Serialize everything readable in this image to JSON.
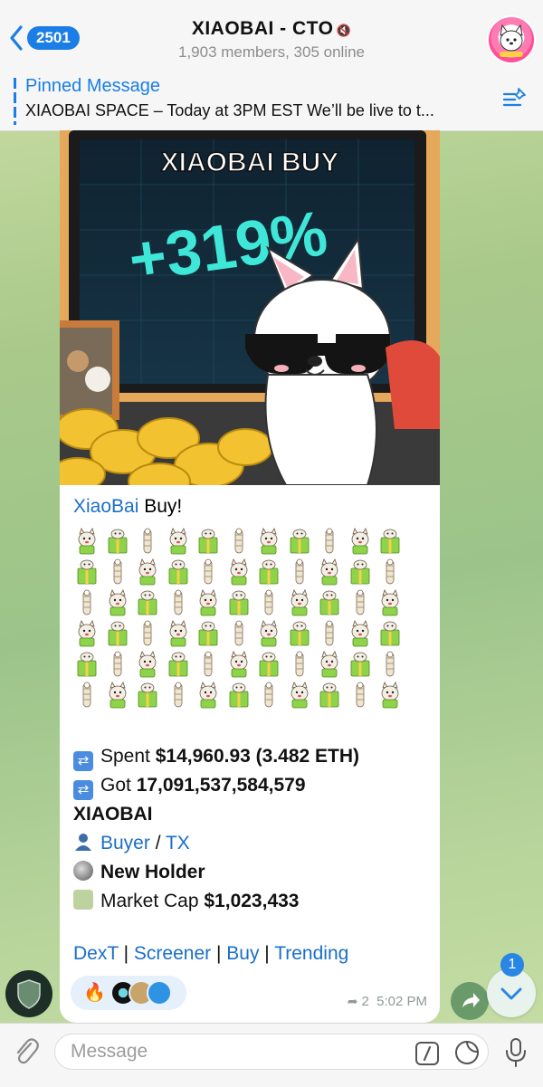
{
  "header": {
    "back_count": "2501",
    "title": "XIAOBAI - CTO",
    "members": "1,903 members, 305 online"
  },
  "pinned": {
    "label": "Pinned Message",
    "text": "XIAOBAI SPACE – Today at 3PM EST We’ll be live to t..."
  },
  "media": {
    "banner_text": "XIAOBAI BUY",
    "percent_text": "+319%"
  },
  "message": {
    "sender": "XiaoBai",
    "sender_suffix": " Buy!",
    "spent_label": "Spent ",
    "spent_value": "$14,960.93 (3.482 ETH)",
    "got_label": "Got ",
    "got_value": "17,091,537,584,579",
    "token": "XIAOBAI",
    "buyer_link": "Buyer",
    "slash": " / ",
    "tx_link": "TX",
    "holder_label": "New Holder",
    "mcap_label": "Market Cap ",
    "mcap_value": "$1,023,433",
    "links": {
      "dext": "DexT",
      "screener": "Screener",
      "buy": "Buy",
      "trending": "Trending",
      "sep": " | "
    },
    "forwards": "2",
    "time": "5:02 PM"
  },
  "down_badge": "1",
  "input": {
    "placeholder": "Message"
  },
  "colors": {
    "accent": "#1a7ee6",
    "link": "#1a6fc9",
    "chat_bg": "#a9c98a"
  }
}
